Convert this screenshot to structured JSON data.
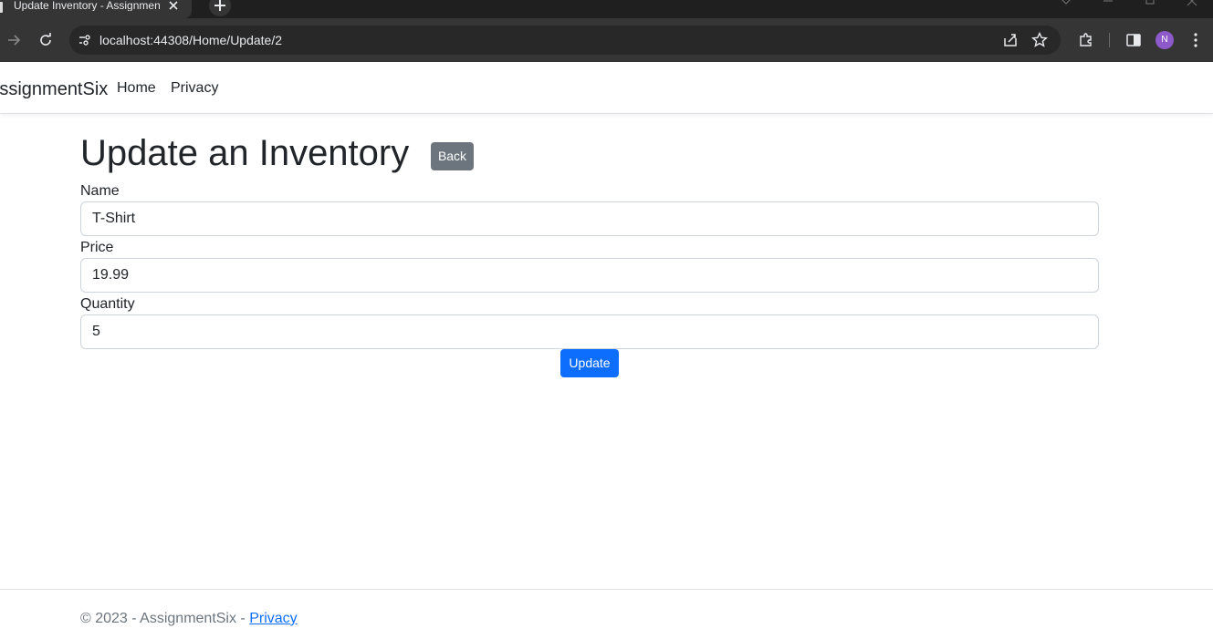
{
  "browser": {
    "tab_title": "Update Inventory - AssignmentSix",
    "url": "localhost:44308/Home/Update/2",
    "profile_initial": "N"
  },
  "navbar": {
    "brand": "AssignmentSix",
    "links": [
      "Home",
      "Privacy"
    ]
  },
  "page": {
    "title": "Update an Inventory",
    "back_label": "Back",
    "fields": [
      {
        "label": "Name",
        "value": "T-Shirt"
      },
      {
        "label": "Price",
        "value": "19.99"
      },
      {
        "label": "Quantity",
        "value": "5"
      }
    ],
    "update_label": "Update"
  },
  "footer": {
    "text": "© 2023 - AssignmentSix - ",
    "link": "Privacy"
  },
  "colors": {
    "primary": "#0d6efd",
    "secondary": "#6c757d",
    "chrome_dark": "#1f1f1f",
    "chrome_toolbar": "#353535",
    "avatar": "#8e59c9"
  }
}
